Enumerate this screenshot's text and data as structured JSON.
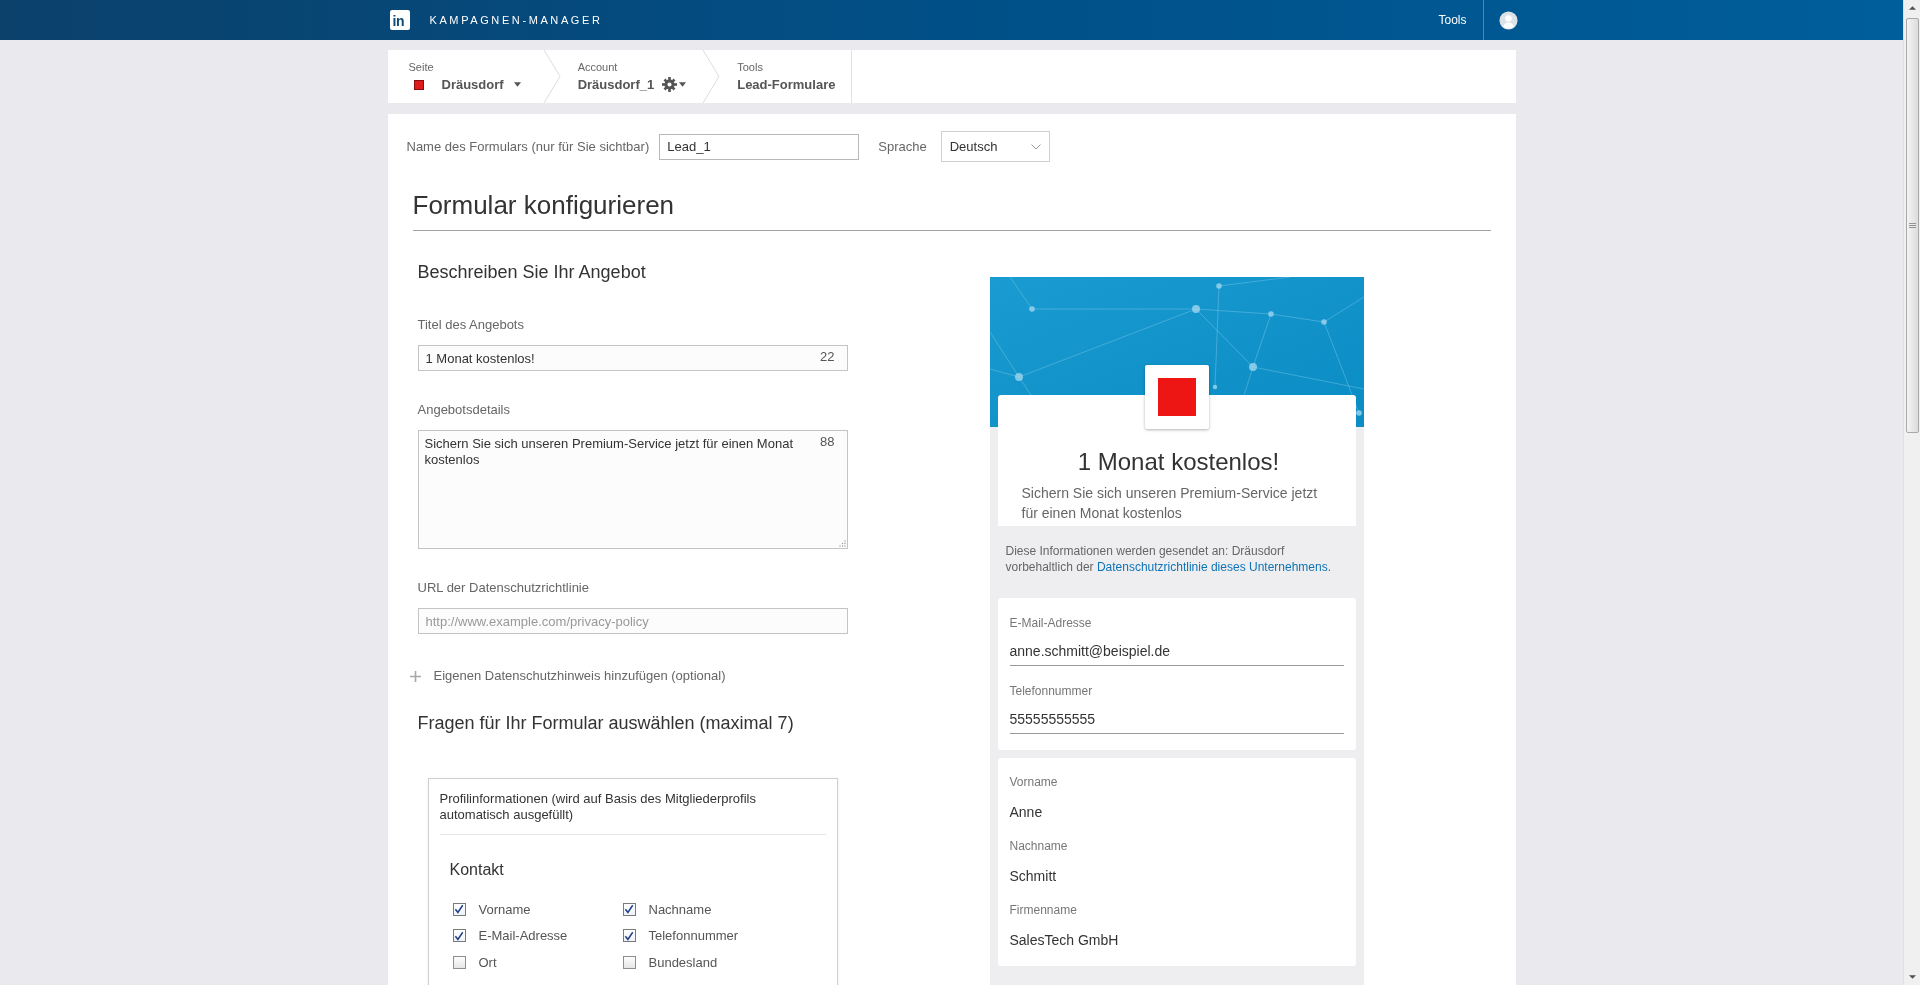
{
  "top_bar": {
    "logo_text": "in",
    "title": "KAMPAGNEN-MANAGER",
    "menu": "Tools"
  },
  "breadcrumb": [
    {
      "kind": "page",
      "label": "Seite",
      "value": "Dräusdorf"
    },
    {
      "kind": "account",
      "label": "Account",
      "value": "Dräusdorf_1"
    },
    {
      "kind": "plain",
      "label": "Tools",
      "value": "Lead-Formulare"
    }
  ],
  "form_name": {
    "label": "Name des Formulars (nur für Sie sichtbar)",
    "value": "Lead_1"
  },
  "language": {
    "label": "Sprache",
    "value": "Deutsch"
  },
  "heading": "Formular konfigurieren",
  "offer": {
    "heading": "Beschreiben Sie Ihr Angebot",
    "fields": [
      {
        "kind": "input",
        "label": "Titel des Angebots",
        "value": "1 Monat kostenlos!",
        "counter": "22"
      },
      {
        "kind": "textarea",
        "label": "Angebotsdetails",
        "value": "Sichern Sie sich unseren Premium-Service jetzt für einen Monat kostenlos",
        "counter": "88"
      },
      {
        "kind": "input",
        "label": "URL der Datenschutzrichtlinie",
        "placeholder": "http://www.example.com/privacy-policy"
      }
    ],
    "add_link": "Eigenen Datenschutzhinweis hinzufügen (optional)"
  },
  "questions": {
    "heading": "Fragen für Ihr Formular auswählen (maximal 7)",
    "panel_title": "Profilinformationen (wird auf Basis des Mitgliederprofils automatisch ausgefüllt)",
    "group": "Kontakt",
    "options": [
      {
        "label": "Vorname",
        "checked": true
      },
      {
        "label": "Nachname",
        "checked": true
      },
      {
        "label": "E-Mail-Adresse",
        "checked": true
      },
      {
        "label": "Telefonnummer",
        "checked": true
      },
      {
        "label": "Ort",
        "checked": false
      },
      {
        "label": "Bundesland",
        "checked": false
      }
    ]
  },
  "preview": {
    "title": "1 Monat kostenlos!",
    "description": "Sichern Sie sich unseren Premium-Service jetzt für einen Monat kostenlos",
    "notice": "Diese Informationen werden gesendet an: Dräusdorf vorbehaltlich der",
    "notice_link": "Datenschutzrichtlinie dieses Unternehmens",
    "notice_end": ".",
    "cards": [
      {
        "kind": "editable",
        "fields": [
          {
            "label": "E-Mail-Adresse",
            "value": "anne.schmitt@beispiel.de"
          },
          {
            "label": "Telefonnummer",
            "value": "55555555555"
          }
        ]
      },
      {
        "kind": "prefilled",
        "fields": [
          {
            "label": "Vorname",
            "value": "Anne"
          },
          {
            "label": "Nachname",
            "value": "Schmitt"
          },
          {
            "label": "Firmenname",
            "value": "SalesTech GmbH"
          }
        ]
      }
    ]
  }
}
